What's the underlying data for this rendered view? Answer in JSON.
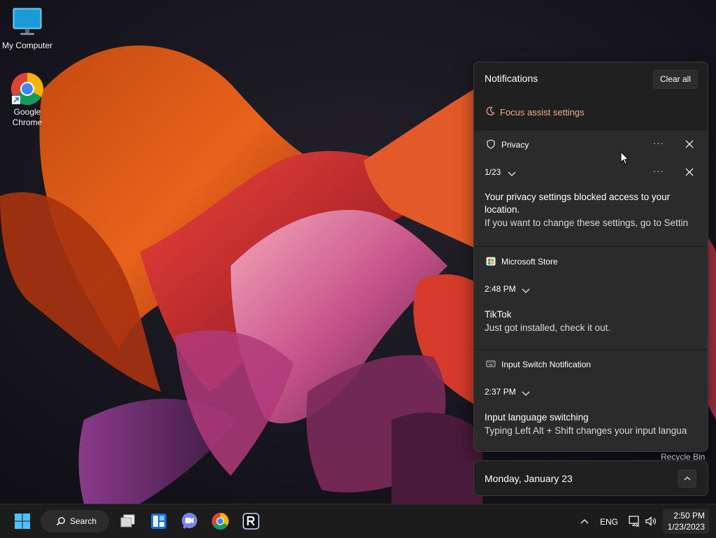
{
  "desktop": {
    "icons": [
      {
        "label": "My Computer",
        "icon": "monitor-icon"
      },
      {
        "label": "Google Chrome",
        "icon": "chrome-icon"
      },
      {
        "label": "Recycle Bin",
        "icon": "recycle-bin-icon"
      }
    ]
  },
  "notifications": {
    "title": "Notifications",
    "clear_all_label": "Clear all",
    "focus_assist_label": "Focus assist settings",
    "more_label": "···",
    "groups": [
      {
        "app": "Privacy",
        "icon": "shield-icon",
        "time": "1/23",
        "title": "Your privacy settings blocked access to your location.",
        "body": "If you want to change these settings, go to Settin"
      },
      {
        "app": "Microsoft Store",
        "icon": "store-icon",
        "time": "2:48 PM",
        "title": "TikTok",
        "body": "Just got installed, check it out."
      },
      {
        "app": "Input Switch Notification",
        "icon": "keyboard-icon",
        "time": "2:37 PM",
        "title": "Input language switching",
        "body": "Typing Left Alt + Shift changes your input langua"
      }
    ]
  },
  "calendar": {
    "date_label": "Monday, January 23"
  },
  "taskbar": {
    "search_label": "Search",
    "language": "ENG",
    "time": "2:50 PM",
    "date": "1/23/2023"
  },
  "colors": {
    "panel_bg": "#202020",
    "card_bg": "#2b2b2b",
    "accent": "#f2aa8c",
    "taskbar_bg": "#1c1c1c"
  }
}
